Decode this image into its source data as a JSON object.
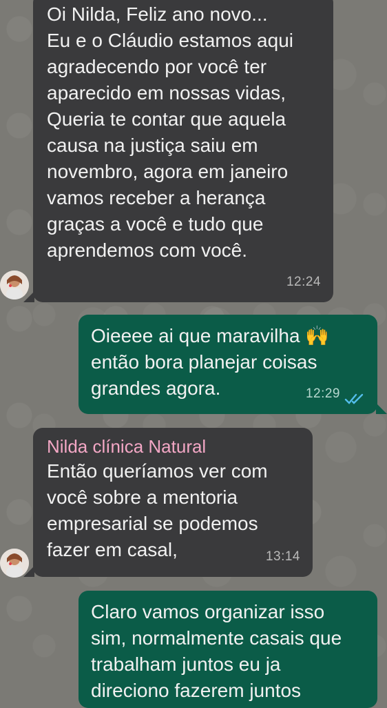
{
  "chat": {
    "messages": [
      {
        "direction": "incoming",
        "text": "Oi Nilda, Feliz ano novo...\nEu e o Cláudio estamos aqui\nagradecendo por você ter\naparecido em nossas vidas,\nQueria te contar que aquela\ncausa na justiça saiu em\nnovembro, agora em janeiro\nvamos receber a herança\ngraças a você e tudo que\naprendemos com você.",
        "time": "12:24"
      },
      {
        "direction": "outgoing",
        "text": "Oieeee ai que maravilha 🙌\nentão bora planejar coisas\ngrandes agora.",
        "time": "12:29",
        "status": "read"
      },
      {
        "direction": "incoming",
        "sender": "Nilda clínica Natural",
        "text": "Então queríamos ver com\nvocê sobre a mentoria\nempresarial se podemos\nfazer em casal,",
        "time": "13:14"
      },
      {
        "direction": "outgoing",
        "text": "Claro vamos organizar isso\nsim, normalmente casais que\ntrabalham juntos eu ja\ndireciono fazerem juntos",
        "time": ""
      }
    ]
  },
  "colors": {
    "incoming_bubble": "#3a3a3c",
    "outgoing_bubble": "#0b5c48",
    "sender_name": "#f3a7c5",
    "read_ticks": "#53bdeb"
  }
}
